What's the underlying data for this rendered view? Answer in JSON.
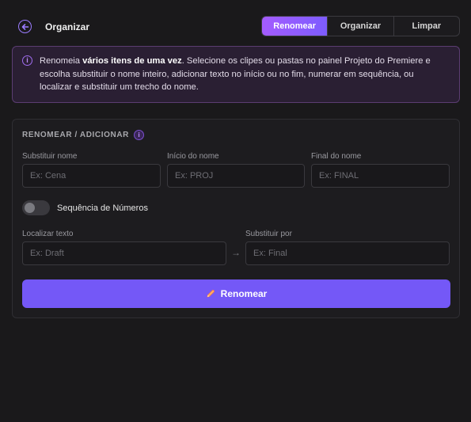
{
  "header": {
    "title": "Organizar",
    "tabs": [
      {
        "label": "Renomear",
        "active": true
      },
      {
        "label": "Organizar",
        "active": false
      },
      {
        "label": "Limpar",
        "active": false
      }
    ]
  },
  "info": {
    "text_before": "Renomeia ",
    "text_bold": "vários itens de uma vez",
    "text_after": ". Selecione os clipes ou pastas no painel Projeto do Premiere e escolha substituir o nome inteiro, adicionar texto no início ou no fim, numerar em sequência, ou localizar e substituir um trecho do nome.",
    "icon": "i"
  },
  "section": {
    "title": "RENOMEAR / ADICIONAR",
    "info_icon": "i"
  },
  "fields": {
    "replace_name": {
      "label": "Substituir nome",
      "placeholder": "Ex: Cena",
      "value": ""
    },
    "name_start": {
      "label": "Início do nome",
      "placeholder": "Ex: PROJ",
      "value": ""
    },
    "name_end": {
      "label": "Final do nome",
      "placeholder": "Ex: FINAL",
      "value": ""
    },
    "find_text": {
      "label": "Localizar texto",
      "placeholder": "Ex: Draft",
      "value": ""
    },
    "replace_with": {
      "label": "Substituir por",
      "placeholder": "Ex: Final",
      "value": ""
    }
  },
  "toggle": {
    "label": "Sequência de Números",
    "on": false
  },
  "arrow": "→",
  "action": {
    "label": "Renomear",
    "icon": "pencil-icon"
  },
  "colors": {
    "accent": "#7458f7",
    "accent_gradient_start": "#a45cff",
    "background": "#1a191b",
    "info_bg": "#2a1f33"
  }
}
